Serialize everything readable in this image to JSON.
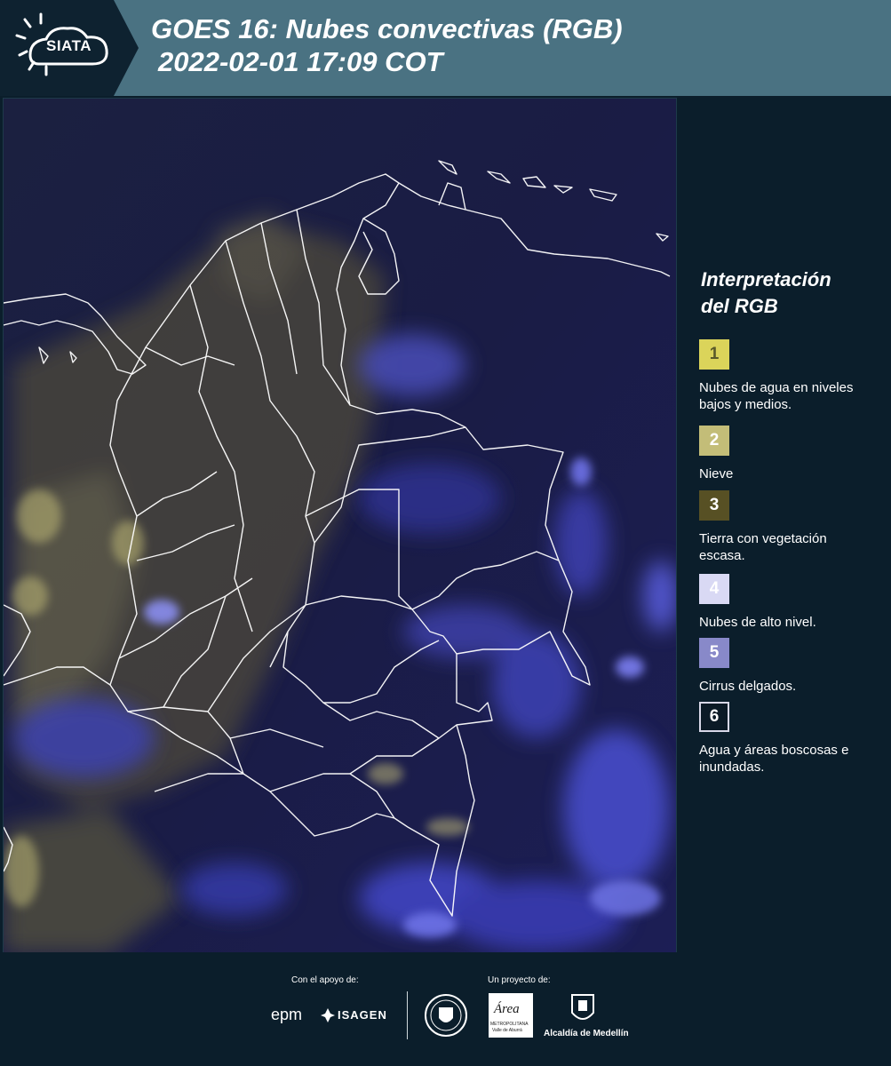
{
  "header": {
    "logo_text": "SIATA",
    "title_line1": "GOES 16: Nubes convectivas (RGB)",
    "title_line2": "2022-02-01 17:09 COT"
  },
  "legend": {
    "title_line1": "Interpretación",
    "title_line2": "del RGB",
    "items": [
      {
        "number": "1",
        "label": "Nubes de agua en niveles bajos y medios.",
        "color": "#dbd45a",
        "text_color": "#5a5a2a"
      },
      {
        "number": "2",
        "label": "Nieve",
        "color": "#c3bd78",
        "text_color": "#ffffff"
      },
      {
        "number": "3",
        "label": "Tierra con vegetación escasa.",
        "color": "#575024",
        "text_color": "#ffffff"
      },
      {
        "number": "4",
        "label": "Nubes de alto nivel.",
        "color": "#d9d9f4",
        "text_color": "#ffffff"
      },
      {
        "number": "5",
        "label": "Cirrus delgados.",
        "color": "#8889c9",
        "text_color": "#ffffff"
      },
      {
        "number": "6",
        "label": "Agua y áreas boscosas e inundadas.",
        "color": "#0b1a26",
        "text_color": "#ffffff"
      }
    ]
  },
  "footer": {
    "support_label": "Con el apoyo de:",
    "project_label": "Un proyecto de:",
    "epm_logo": "epm",
    "isagen_logo": "ISAGEN",
    "area_logo": "Área",
    "area_sub": "METROPOLITANA",
    "area_sub2": "Valle de Aburrá",
    "alcaldia_logo": "Alcaldía de Medellín"
  },
  "colors": {
    "header_bg": "#4a7282",
    "page_bg": "#0b1e2b",
    "map_bg": "#161a45",
    "borders": "#ffffff"
  }
}
